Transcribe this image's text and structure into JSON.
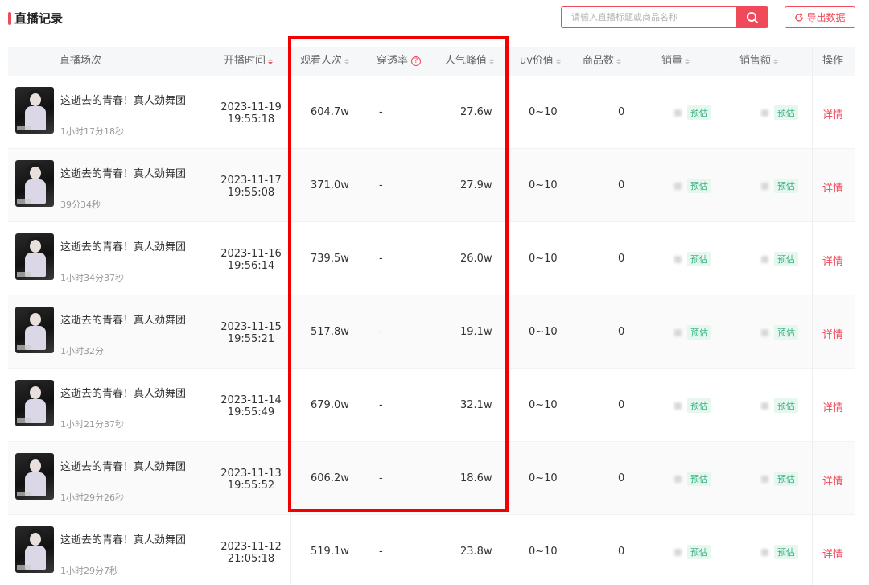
{
  "header": {
    "title": "直播记录",
    "search_placeholder": "请输入直播标题或商品名称",
    "export_label": "导出数据"
  },
  "columns": {
    "session": "直播场次",
    "start_time": "开播时间",
    "views": "观看人次",
    "penetration": "穿透率",
    "peak": "人气峰值",
    "uv": "uv价值",
    "products": "商品数",
    "sales": "销量",
    "revenue": "销售额",
    "action": "操作"
  },
  "rows": [
    {
      "name": "这逝去的青春！真人劲舞团",
      "duration": "1小时17分18秒",
      "date": "2023-11-19",
      "time": "19:55:18",
      "views": "604.7w",
      "penetration": "-",
      "peak": "27.6w",
      "uv": "0~10",
      "products": "0",
      "sales_badge": "预估",
      "revenue_badge": "预估",
      "action": "详情"
    },
    {
      "name": "这逝去的青春！真人劲舞团",
      "duration": "39分34秒",
      "date": "2023-11-17",
      "time": "19:55:08",
      "views": "371.0w",
      "penetration": "-",
      "peak": "27.9w",
      "uv": "0~10",
      "products": "0",
      "sales_badge": "预估",
      "revenue_badge": "预估",
      "action": "详情"
    },
    {
      "name": "这逝去的青春！真人劲舞团",
      "duration": "1小时34分37秒",
      "date": "2023-11-16",
      "time": "19:56:14",
      "views": "739.5w",
      "penetration": "-",
      "peak": "26.0w",
      "uv": "0~10",
      "products": "0",
      "sales_badge": "预估",
      "revenue_badge": "预估",
      "action": "详情"
    },
    {
      "name": "这逝去的青春！真人劲舞团",
      "duration": "1小时32分",
      "date": "2023-11-15",
      "time": "19:55:21",
      "views": "517.8w",
      "penetration": "-",
      "peak": "19.1w",
      "uv": "0~10",
      "products": "0",
      "sales_badge": "预估",
      "revenue_badge": "预估",
      "action": "详情"
    },
    {
      "name": "这逝去的青春！真人劲舞团",
      "duration": "1小时21分37秒",
      "date": "2023-11-14",
      "time": "19:55:49",
      "views": "679.0w",
      "penetration": "-",
      "peak": "32.1w",
      "uv": "0~10",
      "products": "0",
      "sales_badge": "预估",
      "revenue_badge": "预估",
      "action": "详情"
    },
    {
      "name": "这逝去的青春！真人劲舞团",
      "duration": "1小时29分26秒",
      "date": "2023-11-13",
      "time": "19:55:52",
      "views": "606.2w",
      "penetration": "-",
      "peak": "18.6w",
      "uv": "0~10",
      "products": "0",
      "sales_badge": "预估",
      "revenue_badge": "预估",
      "action": "详情"
    },
    {
      "name": "这逝去的青春！真人劲舞团",
      "duration": "1小时29分7秒",
      "date": "2023-11-12",
      "time": "21:05:18",
      "views": "519.1w",
      "penetration": "-",
      "peak": "23.8w",
      "uv": "0~10",
      "products": "0",
      "sales_badge": "预估",
      "revenue_badge": "预估",
      "action": "详情"
    }
  ],
  "colors": {
    "accent": "#f04a5a",
    "highlight_box": "#f20000",
    "badge_text": "#3cb383",
    "badge_bg": "#e6f7ef"
  },
  "icons": {
    "search": "search-icon",
    "export": "refresh-icon",
    "help": "help-circle-icon",
    "sort": "sort-icon"
  }
}
